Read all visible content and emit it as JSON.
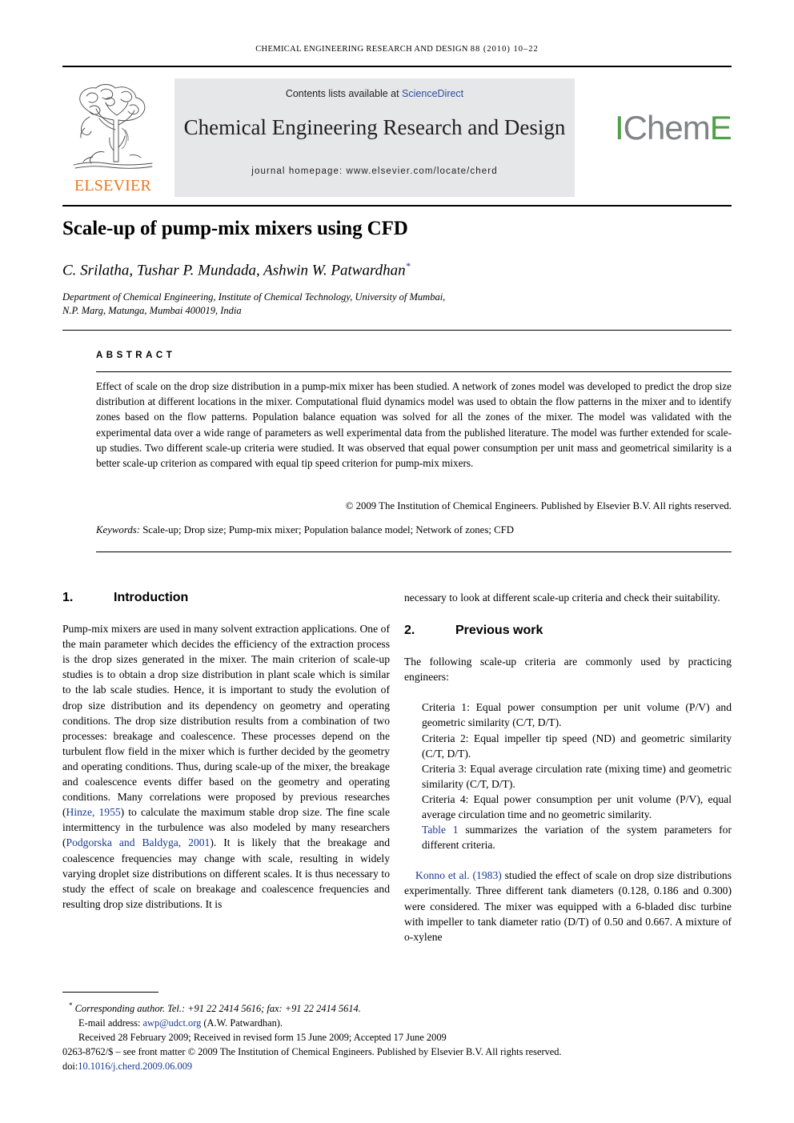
{
  "running_head": {
    "journal": "CHEMICAL ENGINEERING RESEARCH AND DESIGN",
    "volume_year_pages": "88 (2010) 10–22"
  },
  "masthead": {
    "contents_prefix": "Contents lists available at ",
    "contents_link": "ScienceDirect",
    "journal_title": "Chemical Engineering Research and Design",
    "homepage": "journal homepage: www.elsevier.com/locate/cherd",
    "elsevier_wordmark": "ELSEVIER",
    "icheme_i": "I",
    "icheme_chem": "Chem",
    "icheme_e": "E",
    "colors": {
      "elsevier_orange": "#E87722",
      "icheme_green": "#4FA046",
      "icheme_gray": "#808285",
      "banner_gray": "#E6E7E8",
      "link_blue": "#2D4EA0"
    }
  },
  "article": {
    "title": "Scale-up of pump-mix mixers using CFD",
    "authors": "C. Srilatha, Tushar P. Mundada, Ashwin W. Patwardhan",
    "corresponding_marker": "*",
    "affiliation_line1": "Department of Chemical Engineering, Institute of Chemical Technology, University of Mumbai,",
    "affiliation_line2": "N.P. Marg, Matunga, Mumbai 400019, India"
  },
  "abstract": {
    "label": "ABSTRACT",
    "body": "Effect of scale on the drop size distribution in a pump-mix mixer has been studied. A network of zones model was developed to predict the drop size distribution at different locations in the mixer. Computational fluid dynamics model was used to obtain the flow patterns in the mixer and to identify zones based on the flow patterns. Population balance equation was solved for all the zones of the mixer. The model was validated with the experimental data over a wide range of parameters as well experimental data from the published literature. The model was further extended for scale-up studies. Two different scale-up criteria were studied. It was observed that equal power consumption per unit mass and geometrical similarity is a better scale-up criterion as compared with equal tip speed criterion for pump-mix mixers.",
    "copyright": "© 2009 The Institution of Chemical Engineers. Published by Elsevier B.V. All rights reserved.",
    "keywords_label": "Keywords:",
    "keywords_value": "Scale-up; Drop size; Pump-mix mixer; Population balance model; Network of zones; CFD"
  },
  "sections": {
    "intro": {
      "number": "1.",
      "title": "Introduction",
      "para1_a": "Pump-mix mixers are used in many solvent extraction applications. One of the main parameter which decides the efficiency of the extraction process is the drop sizes generated in the mixer. The main criterion of scale-up studies is to obtain a drop size distribution in plant scale which is similar to the lab scale studies. Hence, it is important to study the evolution of drop size distribution and its dependency on geometry and operating conditions. The drop size distribution results from a combination of two processes: breakage and coalescence. These processes depend on the turbulent flow field in the mixer which is further decided by the geometry and operating conditions. Thus, during scale-up of the mixer, the breakage and coalescence events differ based on the geometry and operating conditions. Many correlations were proposed by previous researches (",
      "cite1": "Hinze, 1955",
      "para1_b": ") to calculate the maximum stable drop size. The fine scale intermittency in the turbulence was also modeled by many researchers (",
      "cite2": "Podgorska and Baldyga, 2001",
      "para1_c": "). It is likely that the breakage and coalescence frequencies may change with scale, resulting in widely varying droplet size distributions on different scales. It is thus necessary to study the effect of scale on breakage and coalescence frequencies and resulting drop size distributions. It is",
      "para1_d": "necessary to look at different scale-up criteria and check their suitability."
    },
    "previous_work": {
      "number": "2.",
      "title": "Previous work",
      "intro_para": "The following scale-up criteria are commonly used by practicing engineers:",
      "criteria": [
        "Criteria 1: Equal power consumption per unit volume (P/V) and geometric similarity (C/T, D/T).",
        "Criteria 2: Equal impeller tip speed (ND) and geometric similarity (C/T, D/T).",
        "Criteria 3: Equal average circulation rate (mixing time) and geometric similarity (C/T, D/T).",
        "Criteria 4: Equal power consumption per unit volume (P/V), equal average circulation time and no geometric similarity."
      ],
      "table_ref_prefix": "",
      "table_ref_link": "Table 1",
      "table_ref_suffix": " summarizes the variation of the system parameters for different criteria.",
      "konno_cite": "Konno et al. (1983)",
      "konno_para": " studied the effect of scale on drop size distributions experimentally. Three different tank diameters (0.128, 0.186 and 0.300) were considered. The mixer was equipped with a 6-bladed disc turbine with impeller to tank diameter ratio (D/T) of 0.50 and 0.667. A mixture of o-xylene"
    }
  },
  "footnotes": {
    "corresponding": "Corresponding author. Tel.: +91 22 2414 5616; fax: +91 22 2414 5614.",
    "email_label": "E-mail address: ",
    "email": "awp@udct.org",
    "email_suffix": " (A.W. Patwardhan).",
    "dates": "Received 28 February 2009; Received in revised form 15 June 2009; Accepted 17 June 2009",
    "issn_line": "0263-8762/$ – see front matter © 2009 The Institution of Chemical Engineers. Published by Elsevier B.V. All rights reserved.",
    "doi_label": "doi:",
    "doi_value": "10.1016/j.cherd.2009.06.009"
  }
}
